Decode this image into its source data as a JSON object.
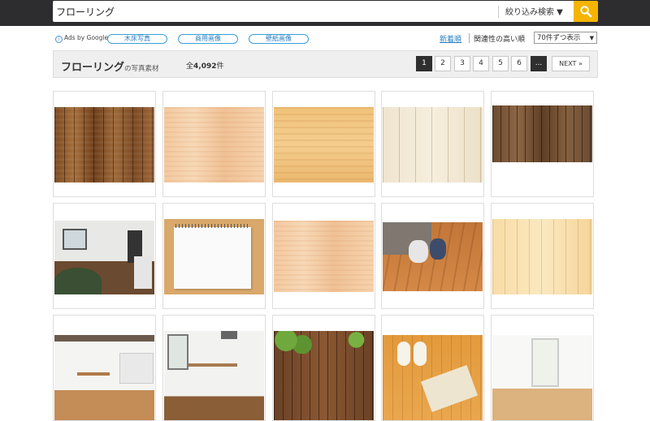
{
  "search": {
    "query": "フローリング",
    "filter_label": "絞り込み検索 ▼",
    "button_icon": "search-icon"
  },
  "ads": {
    "label": "Ads by Google",
    "tags": [
      "木床写真",
      "商用画像",
      "壁紙画像"
    ]
  },
  "sort": {
    "newest": "新着順",
    "relevance": "関連性の高い順",
    "per_page": "70件ずつ表示"
  },
  "header": {
    "title": "フローリング",
    "title_suffix": "の写真素材",
    "total_prefix": "全",
    "total_count": "4,092",
    "total_suffix": "件"
  },
  "pagination": {
    "pages": [
      "1",
      "2",
      "3",
      "4",
      "5",
      "6"
    ],
    "current": "1",
    "ellipsis": "...",
    "next": "NEXT »"
  },
  "colors": {
    "topbar": "#2d2d30",
    "search_button": "#f5b400",
    "tag_border": "#3aa0d8",
    "pager_active": "#2f2f2f"
  },
  "photos": [
    {
      "name": "photo-dark-vertical-planks"
    },
    {
      "name": "photo-light-wood-grain"
    },
    {
      "name": "photo-medium-wood-grain"
    },
    {
      "name": "photo-whitewashed-planks"
    },
    {
      "name": "photo-weathered-planks"
    },
    {
      "name": "photo-living-room"
    },
    {
      "name": "photo-notebook-on-wood"
    },
    {
      "name": "photo-light-wood-board"
    },
    {
      "name": "photo-people-on-sofa"
    },
    {
      "name": "photo-pale-wood-planks"
    },
    {
      "name": "photo-kitchen-dining"
    },
    {
      "name": "photo-dining-table-room"
    },
    {
      "name": "photo-ivy-on-planks"
    },
    {
      "name": "photo-slippers-on-floor"
    },
    {
      "name": "photo-empty-room"
    }
  ]
}
